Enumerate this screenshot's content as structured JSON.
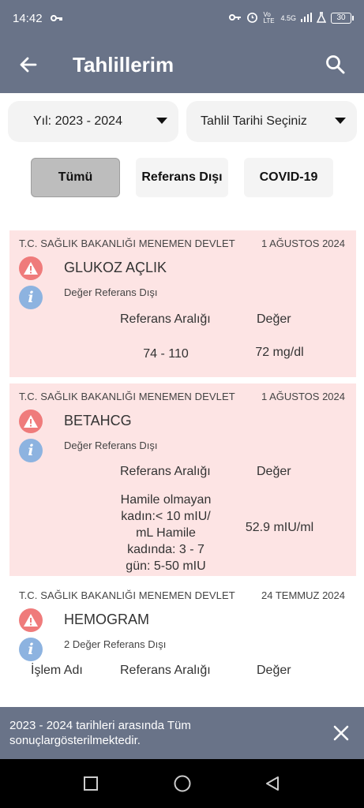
{
  "status_bar": {
    "time": "14:42",
    "network_label": "4.5G",
    "volte_label": "Vo LTE",
    "battery": "30"
  },
  "app_bar": {
    "title": "Tahlillerim"
  },
  "filters": {
    "year_dropdown": "Yıl: 2023 - 2024",
    "date_dropdown": "Tahlil Tarihi Seçiniz",
    "chips": [
      "Tümü",
      "Referans Dışı",
      "COVID-19"
    ],
    "selected_chip": "Tümü"
  },
  "results": [
    {
      "institution": "T.C. SAĞLIK BAKANLIĞI MENEMEN DEVLET",
      "date": "1 AĞUSTOS 2024",
      "test_name": "GLUKOZ AÇLIK",
      "status": "Değer Referans Dışı",
      "ref_header": "Referans Aralığı",
      "value_header": "Değer",
      "ref_range": "74 - 110",
      "value": "72 mg/dl",
      "highlight_color": "#fde4e4"
    },
    {
      "institution": "T.C. SAĞLIK BAKANLIĞI MENEMEN DEVLET",
      "date": "1 AĞUSTOS 2024",
      "test_name": "BETAHCG",
      "status": "Değer Referans Dışı",
      "ref_header": "Referans Aralığı",
      "value_header": "Değer",
      "ref_range": "Hamile olmayan kadın:< 10 mIU/ mL Hamile kadında: 3 - 7 gün: 5-50 mIU",
      "value": "52.9 mIU/ml",
      "highlight_color": "#fde4e4"
    },
    {
      "institution": "T.C. SAĞLIK BAKANLIĞI MENEMEN DEVLET",
      "date": "24 TEMMUZ 2024",
      "test_name": "HEMOGRAM",
      "status": "2 Değer Referans Dışı",
      "name_header": "İşlem Adı",
      "ref_header": "Referans Aralığı",
      "value_header": "Değer"
    }
  ],
  "snackbar": {
    "message": "2023 - 2024 tarihleri arasında Tüm sonuçlargösterilmektedir."
  },
  "colors": {
    "primary": "#697388",
    "alert_bg": "#fde4e4",
    "warning_icon": "#ef7b7b",
    "info_icon": "#8db3e0",
    "selected_chip": "#bdbdbd"
  },
  "icons": {
    "back": "arrow-left-icon",
    "search": "search-icon",
    "warning": "warning-triangle-icon",
    "info": "info-icon",
    "close": "close-icon",
    "dropdown": "caret-down-icon"
  }
}
